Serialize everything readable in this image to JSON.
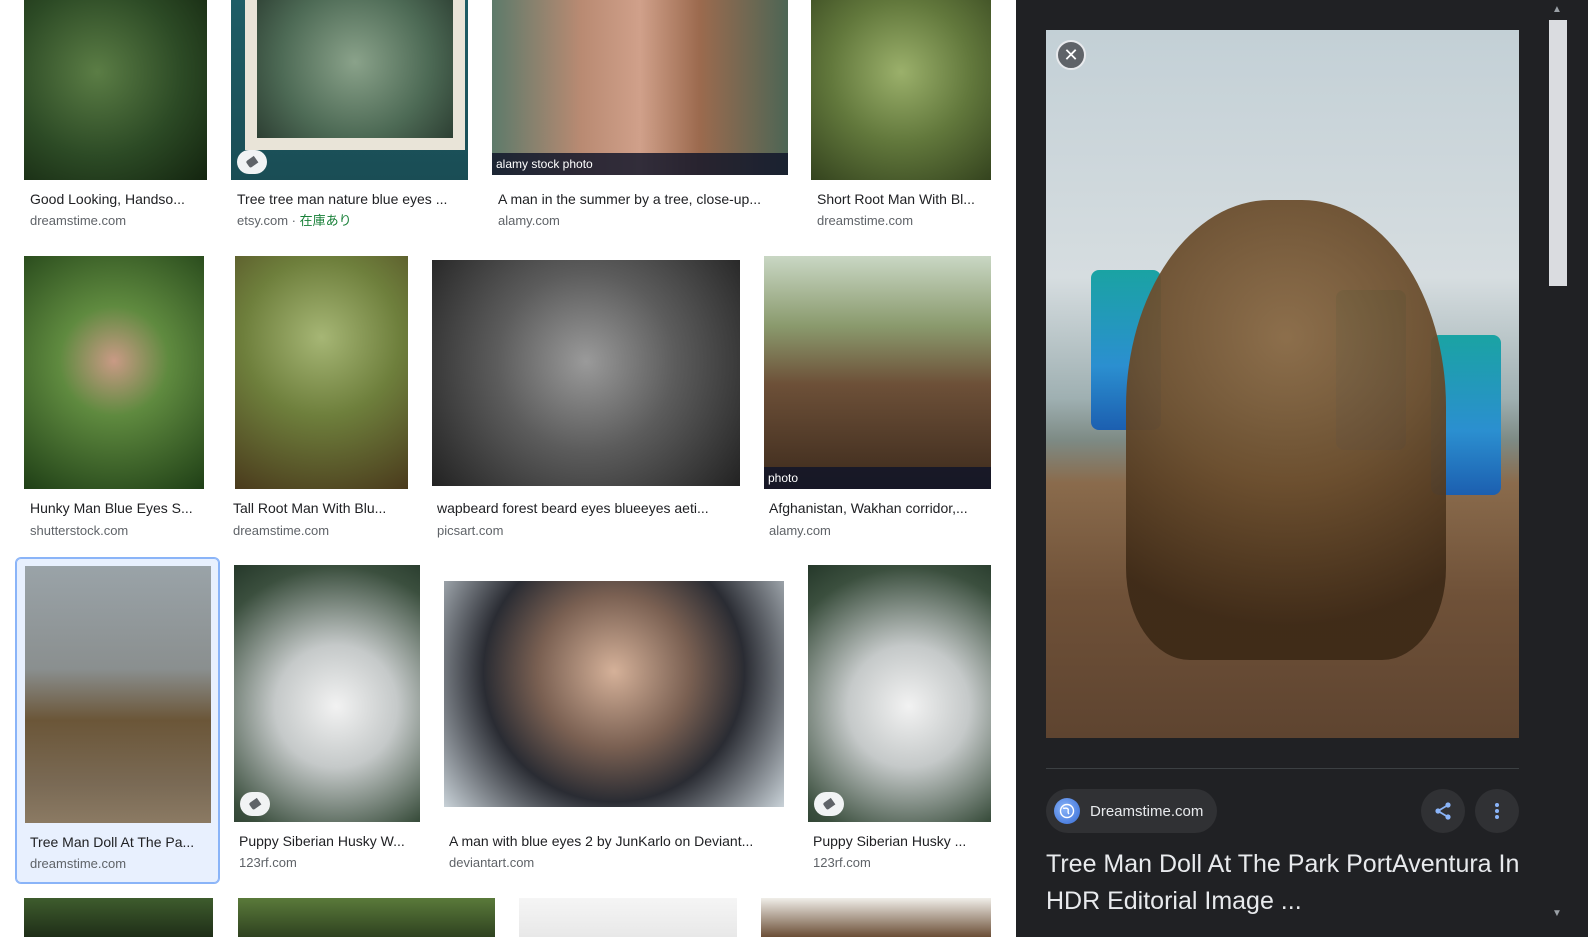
{
  "results": [
    {
      "title": "Good Looking, Handso...",
      "source": "dreamstime.com"
    },
    {
      "title": "Tree tree man nature blue eyes ...",
      "source": "etsy.com",
      "stock": "在庫あり"
    },
    {
      "title": "A man in the summer by a tree, close-up...",
      "source": "alamy.com",
      "overlay": "alamy stock photo"
    },
    {
      "title": "Short Root Man With Bl...",
      "source": "dreamstime.com"
    },
    {
      "title": "Hunky Man Blue Eyes S...",
      "source": "shutterstock.com"
    },
    {
      "title": "Tall Root Man With Blu...",
      "source": "dreamstime.com"
    },
    {
      "title": "wapbeard forest beard eyes blueeyes aeti...",
      "source": "picsart.com"
    },
    {
      "title": "Afghanistan, Wakhan corridor,...",
      "source": "alamy.com",
      "overlay": "photo"
    },
    {
      "title": "Tree Man Doll At The Pa...",
      "source": "dreamstime.com"
    },
    {
      "title": "Puppy Siberian Husky W...",
      "source": "123rf.com"
    },
    {
      "title": "A man with blue eyes 2 by JunKarlo on Deviant...",
      "source": "deviantart.com"
    },
    {
      "title": "Puppy Siberian Husky ...",
      "source": "123rf.com"
    }
  ],
  "panel": {
    "source_label": "Dreamstime.com",
    "title": "Tree Man Doll At The Park PortAventura In HDR Editorial Image ...",
    "close_glyph": "✕",
    "source_icon": "globe-icon",
    "share_icon": "share-icon",
    "more_icon": "more-vert-icon"
  },
  "colors": {
    "panel_bg": "#202124",
    "selected_border": "#8ab4f8",
    "stock_green": "#188038"
  }
}
